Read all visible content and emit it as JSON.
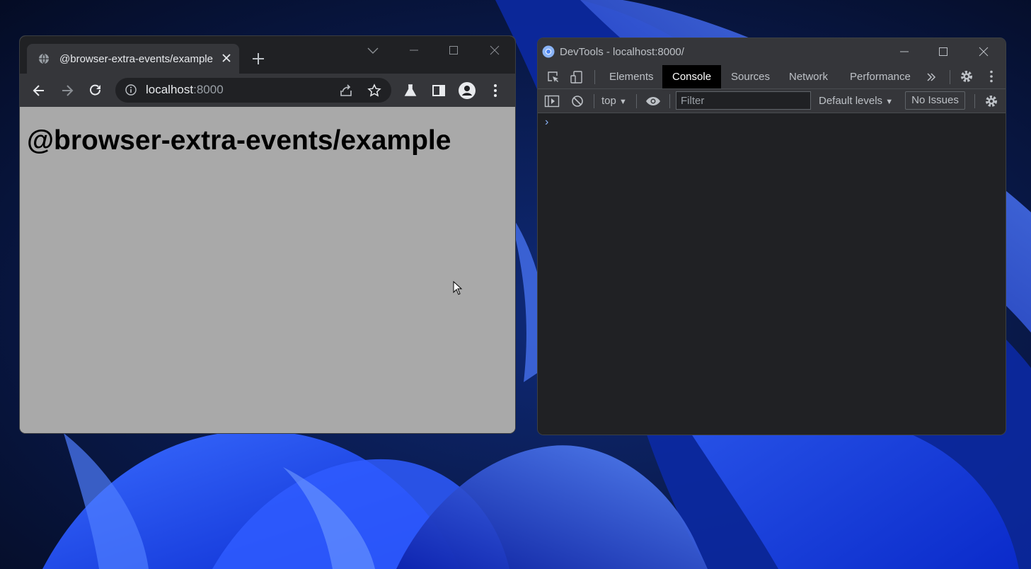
{
  "colors": {
    "desktop_background": "#071433",
    "chrome_frame": "#202124",
    "chrome_toolbar": "#35363a",
    "page_background": "#a9a9a9",
    "devtools_background": "#202124",
    "devtools_accent": "#8ab4f8"
  },
  "browser": {
    "tab": {
      "title": "@browser-extra-events/example",
      "favicon": "globe-icon",
      "close_icon": "close-icon"
    },
    "new_tab_icon": "plus-icon",
    "tab_search_icon": "chevron-down-icon",
    "window_controls": [
      "minimize-icon",
      "maximize-icon",
      "close-icon"
    ],
    "toolbar": {
      "nav_icons": [
        "back-arrow-icon",
        "forward-arrow-icon",
        "reload-icon"
      ],
      "address": {
        "security_icon": "info-icon",
        "host": "localhost",
        "port": ":8000"
      },
      "right_icons": [
        "share-icon",
        "star-icon",
        "labs-flask-icon",
        "side-panel-icon",
        "profile-icon",
        "menu-kebab-icon"
      ]
    },
    "page": {
      "heading": "@browser-extra-events/example"
    }
  },
  "devtools": {
    "window_title": "DevTools - localhost:8000/",
    "tabs": [
      {
        "label": "Elements"
      },
      {
        "label": "Console",
        "active": true
      },
      {
        "label": "Sources"
      },
      {
        "label": "Network"
      },
      {
        "label": "Performance"
      }
    ],
    "more_tabs_icon": "double-chevron-right-icon",
    "console_toolbar": {
      "context": "top",
      "filter_placeholder": "Filter",
      "levels": "Default levels",
      "issues": "No Issues"
    },
    "console_prompt": "›"
  }
}
